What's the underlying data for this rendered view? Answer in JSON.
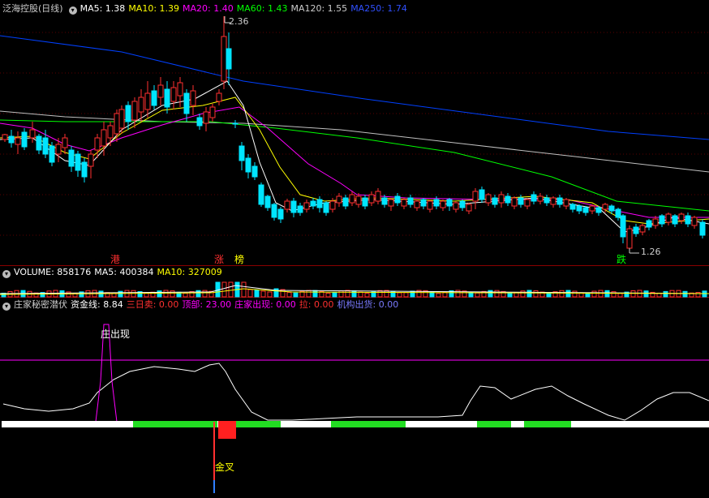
{
  "main": {
    "title": "泛海控股(日线)",
    "ma": [
      {
        "label": "MA5: 1.38",
        "color": "#ffffff"
      },
      {
        "label": "MA10: 1.39",
        "color": "#ffff00"
      },
      {
        "label": "MA20: 1.40",
        "color": "#ff00ff"
      },
      {
        "label": "MA60: 1.43",
        "color": "#00ff00"
      },
      {
        "label": "MA120: 1.55",
        "color": "#c0c0c0"
      },
      {
        "label": "MA250: 1.74",
        "color": "#0040ff"
      }
    ],
    "high_label": "2.36",
    "low_label": "1.26",
    "signals": {
      "gang": "港",
      "zhang": "涨",
      "bang": "榜",
      "die": "跌"
    }
  },
  "volume": {
    "items": [
      {
        "label": "VOLUME: 858176",
        "color": "#ffffff"
      },
      {
        "label": "MA5: 400384",
        "color": "#ffffff"
      },
      {
        "label": "MA10: 327009",
        "color": "#ffff00"
      }
    ]
  },
  "indicator": {
    "title": "庄家秘密潜伏",
    "items": [
      {
        "label": "资金线: 8.84",
        "color": "#ffffff"
      },
      {
        "label": "三日卖: 0.00",
        "color": "#ff3030"
      },
      {
        "label": "顶部: 23.00",
        "color": "#ff00ff"
      },
      {
        "label": "庄家出现: 0.00",
        "color": "#ff00ff"
      },
      {
        "label": "拉: 0.00",
        "color": "#ff3030"
      },
      {
        "label": "机构出货: 0.00",
        "color": "#7070ff"
      }
    ],
    "zhuang_label": "庄出现",
    "jincha_label": "金叉"
  },
  "colors": {
    "up": "#ff3030",
    "down": "#00e5ff",
    "ma5": "#ffffff",
    "ma10": "#ffff00",
    "ma20": "#ff00ff",
    "ma60": "#00ff00",
    "ma120": "#c0c0c0",
    "ma250": "#0040ff"
  }
}
